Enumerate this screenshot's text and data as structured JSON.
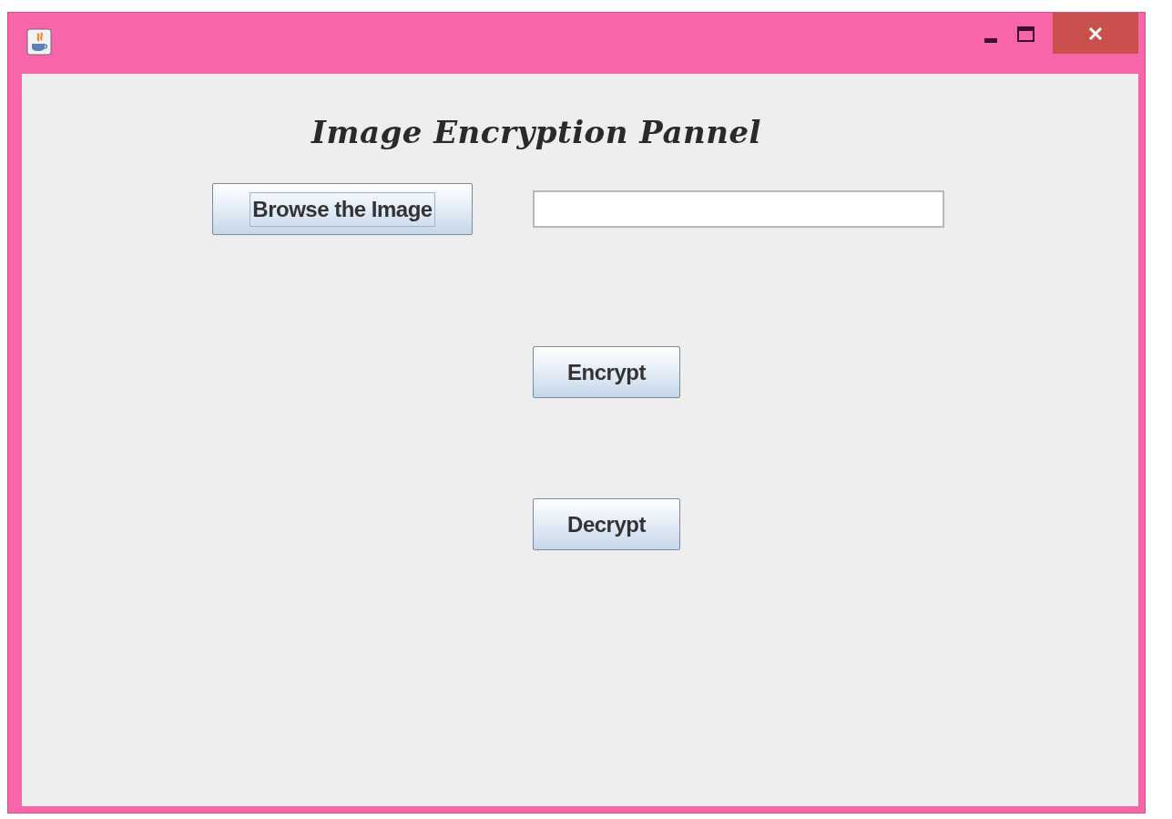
{
  "heading": "Image Encryption Pannel",
  "browse_button": {
    "label": "Browse the Image",
    "focused": true
  },
  "action_buttons": [
    {
      "label": "Encrypt",
      "focused": false
    },
    {
      "label": "Decrypt",
      "focused": false
    }
  ]
}
